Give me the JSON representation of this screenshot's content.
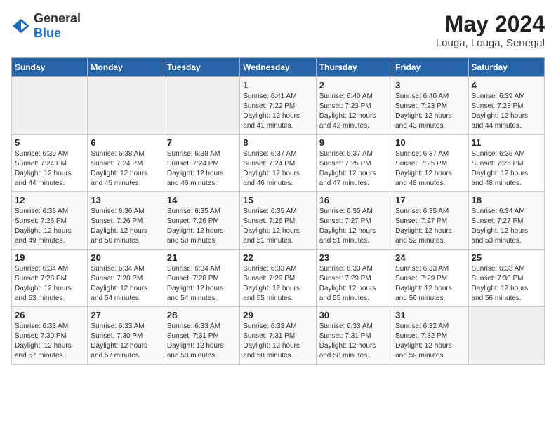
{
  "logo": {
    "general": "General",
    "blue": "Blue"
  },
  "title": "May 2024",
  "location": "Louga, Louga, Senegal",
  "headers": [
    "Sunday",
    "Monday",
    "Tuesday",
    "Wednesday",
    "Thursday",
    "Friday",
    "Saturday"
  ],
  "weeks": [
    [
      {
        "day": "",
        "info": ""
      },
      {
        "day": "",
        "info": ""
      },
      {
        "day": "",
        "info": ""
      },
      {
        "day": "1",
        "info": "Sunrise: 6:41 AM\nSunset: 7:22 PM\nDaylight: 12 hours\nand 41 minutes."
      },
      {
        "day": "2",
        "info": "Sunrise: 6:40 AM\nSunset: 7:23 PM\nDaylight: 12 hours\nand 42 minutes."
      },
      {
        "day": "3",
        "info": "Sunrise: 6:40 AM\nSunset: 7:23 PM\nDaylight: 12 hours\nand 43 minutes."
      },
      {
        "day": "4",
        "info": "Sunrise: 6:39 AM\nSunset: 7:23 PM\nDaylight: 12 hours\nand 44 minutes."
      }
    ],
    [
      {
        "day": "5",
        "info": "Sunrise: 6:39 AM\nSunset: 7:24 PM\nDaylight: 12 hours\nand 44 minutes."
      },
      {
        "day": "6",
        "info": "Sunrise: 6:38 AM\nSunset: 7:24 PM\nDaylight: 12 hours\nand 45 minutes."
      },
      {
        "day": "7",
        "info": "Sunrise: 6:38 AM\nSunset: 7:24 PM\nDaylight: 12 hours\nand 46 minutes."
      },
      {
        "day": "8",
        "info": "Sunrise: 6:37 AM\nSunset: 7:24 PM\nDaylight: 12 hours\nand 46 minutes."
      },
      {
        "day": "9",
        "info": "Sunrise: 6:37 AM\nSunset: 7:25 PM\nDaylight: 12 hours\nand 47 minutes."
      },
      {
        "day": "10",
        "info": "Sunrise: 6:37 AM\nSunset: 7:25 PM\nDaylight: 12 hours\nand 48 minutes."
      },
      {
        "day": "11",
        "info": "Sunrise: 6:36 AM\nSunset: 7:25 PM\nDaylight: 12 hours\nand 48 minutes."
      }
    ],
    [
      {
        "day": "12",
        "info": "Sunrise: 6:36 AM\nSunset: 7:26 PM\nDaylight: 12 hours\nand 49 minutes."
      },
      {
        "day": "13",
        "info": "Sunrise: 6:36 AM\nSunset: 7:26 PM\nDaylight: 12 hours\nand 50 minutes."
      },
      {
        "day": "14",
        "info": "Sunrise: 6:35 AM\nSunset: 7:26 PM\nDaylight: 12 hours\nand 50 minutes."
      },
      {
        "day": "15",
        "info": "Sunrise: 6:35 AM\nSunset: 7:26 PM\nDaylight: 12 hours\nand 51 minutes."
      },
      {
        "day": "16",
        "info": "Sunrise: 6:35 AM\nSunset: 7:27 PM\nDaylight: 12 hours\nand 51 minutes."
      },
      {
        "day": "17",
        "info": "Sunrise: 6:35 AM\nSunset: 7:27 PM\nDaylight: 12 hours\nand 52 minutes."
      },
      {
        "day": "18",
        "info": "Sunrise: 6:34 AM\nSunset: 7:27 PM\nDaylight: 12 hours\nand 53 minutes."
      }
    ],
    [
      {
        "day": "19",
        "info": "Sunrise: 6:34 AM\nSunset: 7:28 PM\nDaylight: 12 hours\nand 53 minutes."
      },
      {
        "day": "20",
        "info": "Sunrise: 6:34 AM\nSunset: 7:28 PM\nDaylight: 12 hours\nand 54 minutes."
      },
      {
        "day": "21",
        "info": "Sunrise: 6:34 AM\nSunset: 7:28 PM\nDaylight: 12 hours\nand 54 minutes."
      },
      {
        "day": "22",
        "info": "Sunrise: 6:33 AM\nSunset: 7:29 PM\nDaylight: 12 hours\nand 55 minutes."
      },
      {
        "day": "23",
        "info": "Sunrise: 6:33 AM\nSunset: 7:29 PM\nDaylight: 12 hours\nand 55 minutes."
      },
      {
        "day": "24",
        "info": "Sunrise: 6:33 AM\nSunset: 7:29 PM\nDaylight: 12 hours\nand 56 minutes."
      },
      {
        "day": "25",
        "info": "Sunrise: 6:33 AM\nSunset: 7:30 PM\nDaylight: 12 hours\nand 56 minutes."
      }
    ],
    [
      {
        "day": "26",
        "info": "Sunrise: 6:33 AM\nSunset: 7:30 PM\nDaylight: 12 hours\nand 57 minutes."
      },
      {
        "day": "27",
        "info": "Sunrise: 6:33 AM\nSunset: 7:30 PM\nDaylight: 12 hours\nand 57 minutes."
      },
      {
        "day": "28",
        "info": "Sunrise: 6:33 AM\nSunset: 7:31 PM\nDaylight: 12 hours\nand 58 minutes."
      },
      {
        "day": "29",
        "info": "Sunrise: 6:33 AM\nSunset: 7:31 PM\nDaylight: 12 hours\nand 58 minutes."
      },
      {
        "day": "30",
        "info": "Sunrise: 6:33 AM\nSunset: 7:31 PM\nDaylight: 12 hours\nand 58 minutes."
      },
      {
        "day": "31",
        "info": "Sunrise: 6:32 AM\nSunset: 7:32 PM\nDaylight: 12 hours\nand 59 minutes."
      },
      {
        "day": "",
        "info": ""
      }
    ]
  ]
}
